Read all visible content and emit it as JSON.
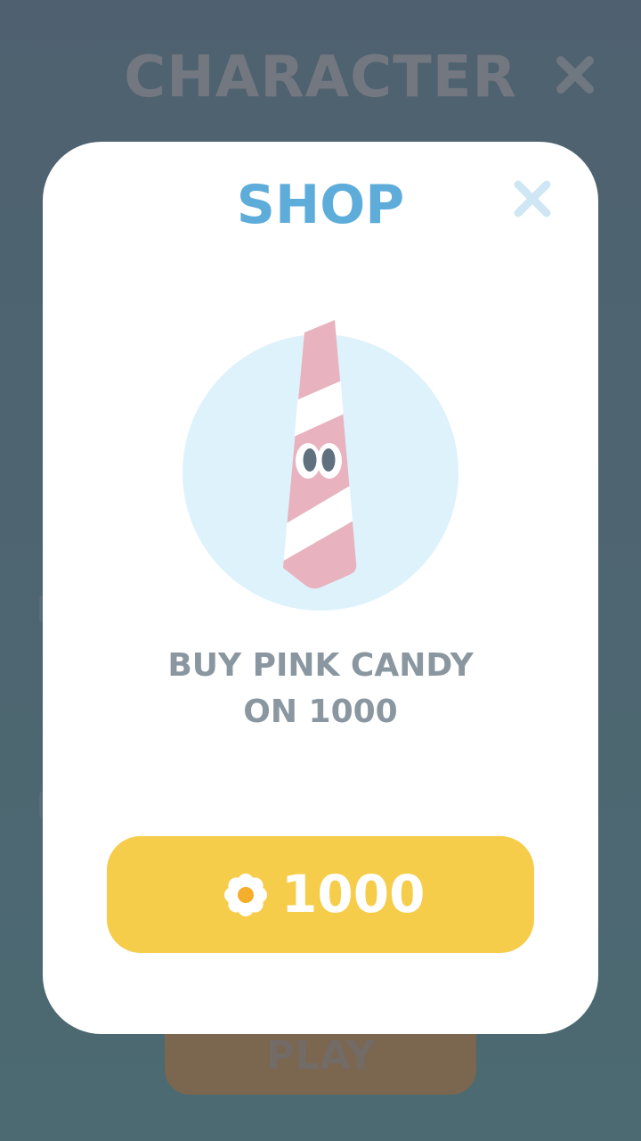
{
  "background": {
    "title": "CHARACTER",
    "close_icon": "close-icon",
    "play_label": "PLAY"
  },
  "modal": {
    "title": "SHOP",
    "close_icon": "close-icon",
    "item": {
      "name": "PINK CANDY",
      "icon": "pink-candy-character-icon"
    },
    "offer_line1": "BUY PINK CANDY",
    "offer_line2": "ON 1000",
    "buy_button": {
      "currency_icon": "flower-coin-icon",
      "price": "1000"
    }
  },
  "colors": {
    "overlay": "#4f6170",
    "title_blue": "#5eacd9",
    "button_yellow": "#f6cd4a",
    "text_gray": "#8a97a0",
    "candy_pink": "#e8b2be",
    "preview_circle": "#ddf2fb"
  }
}
